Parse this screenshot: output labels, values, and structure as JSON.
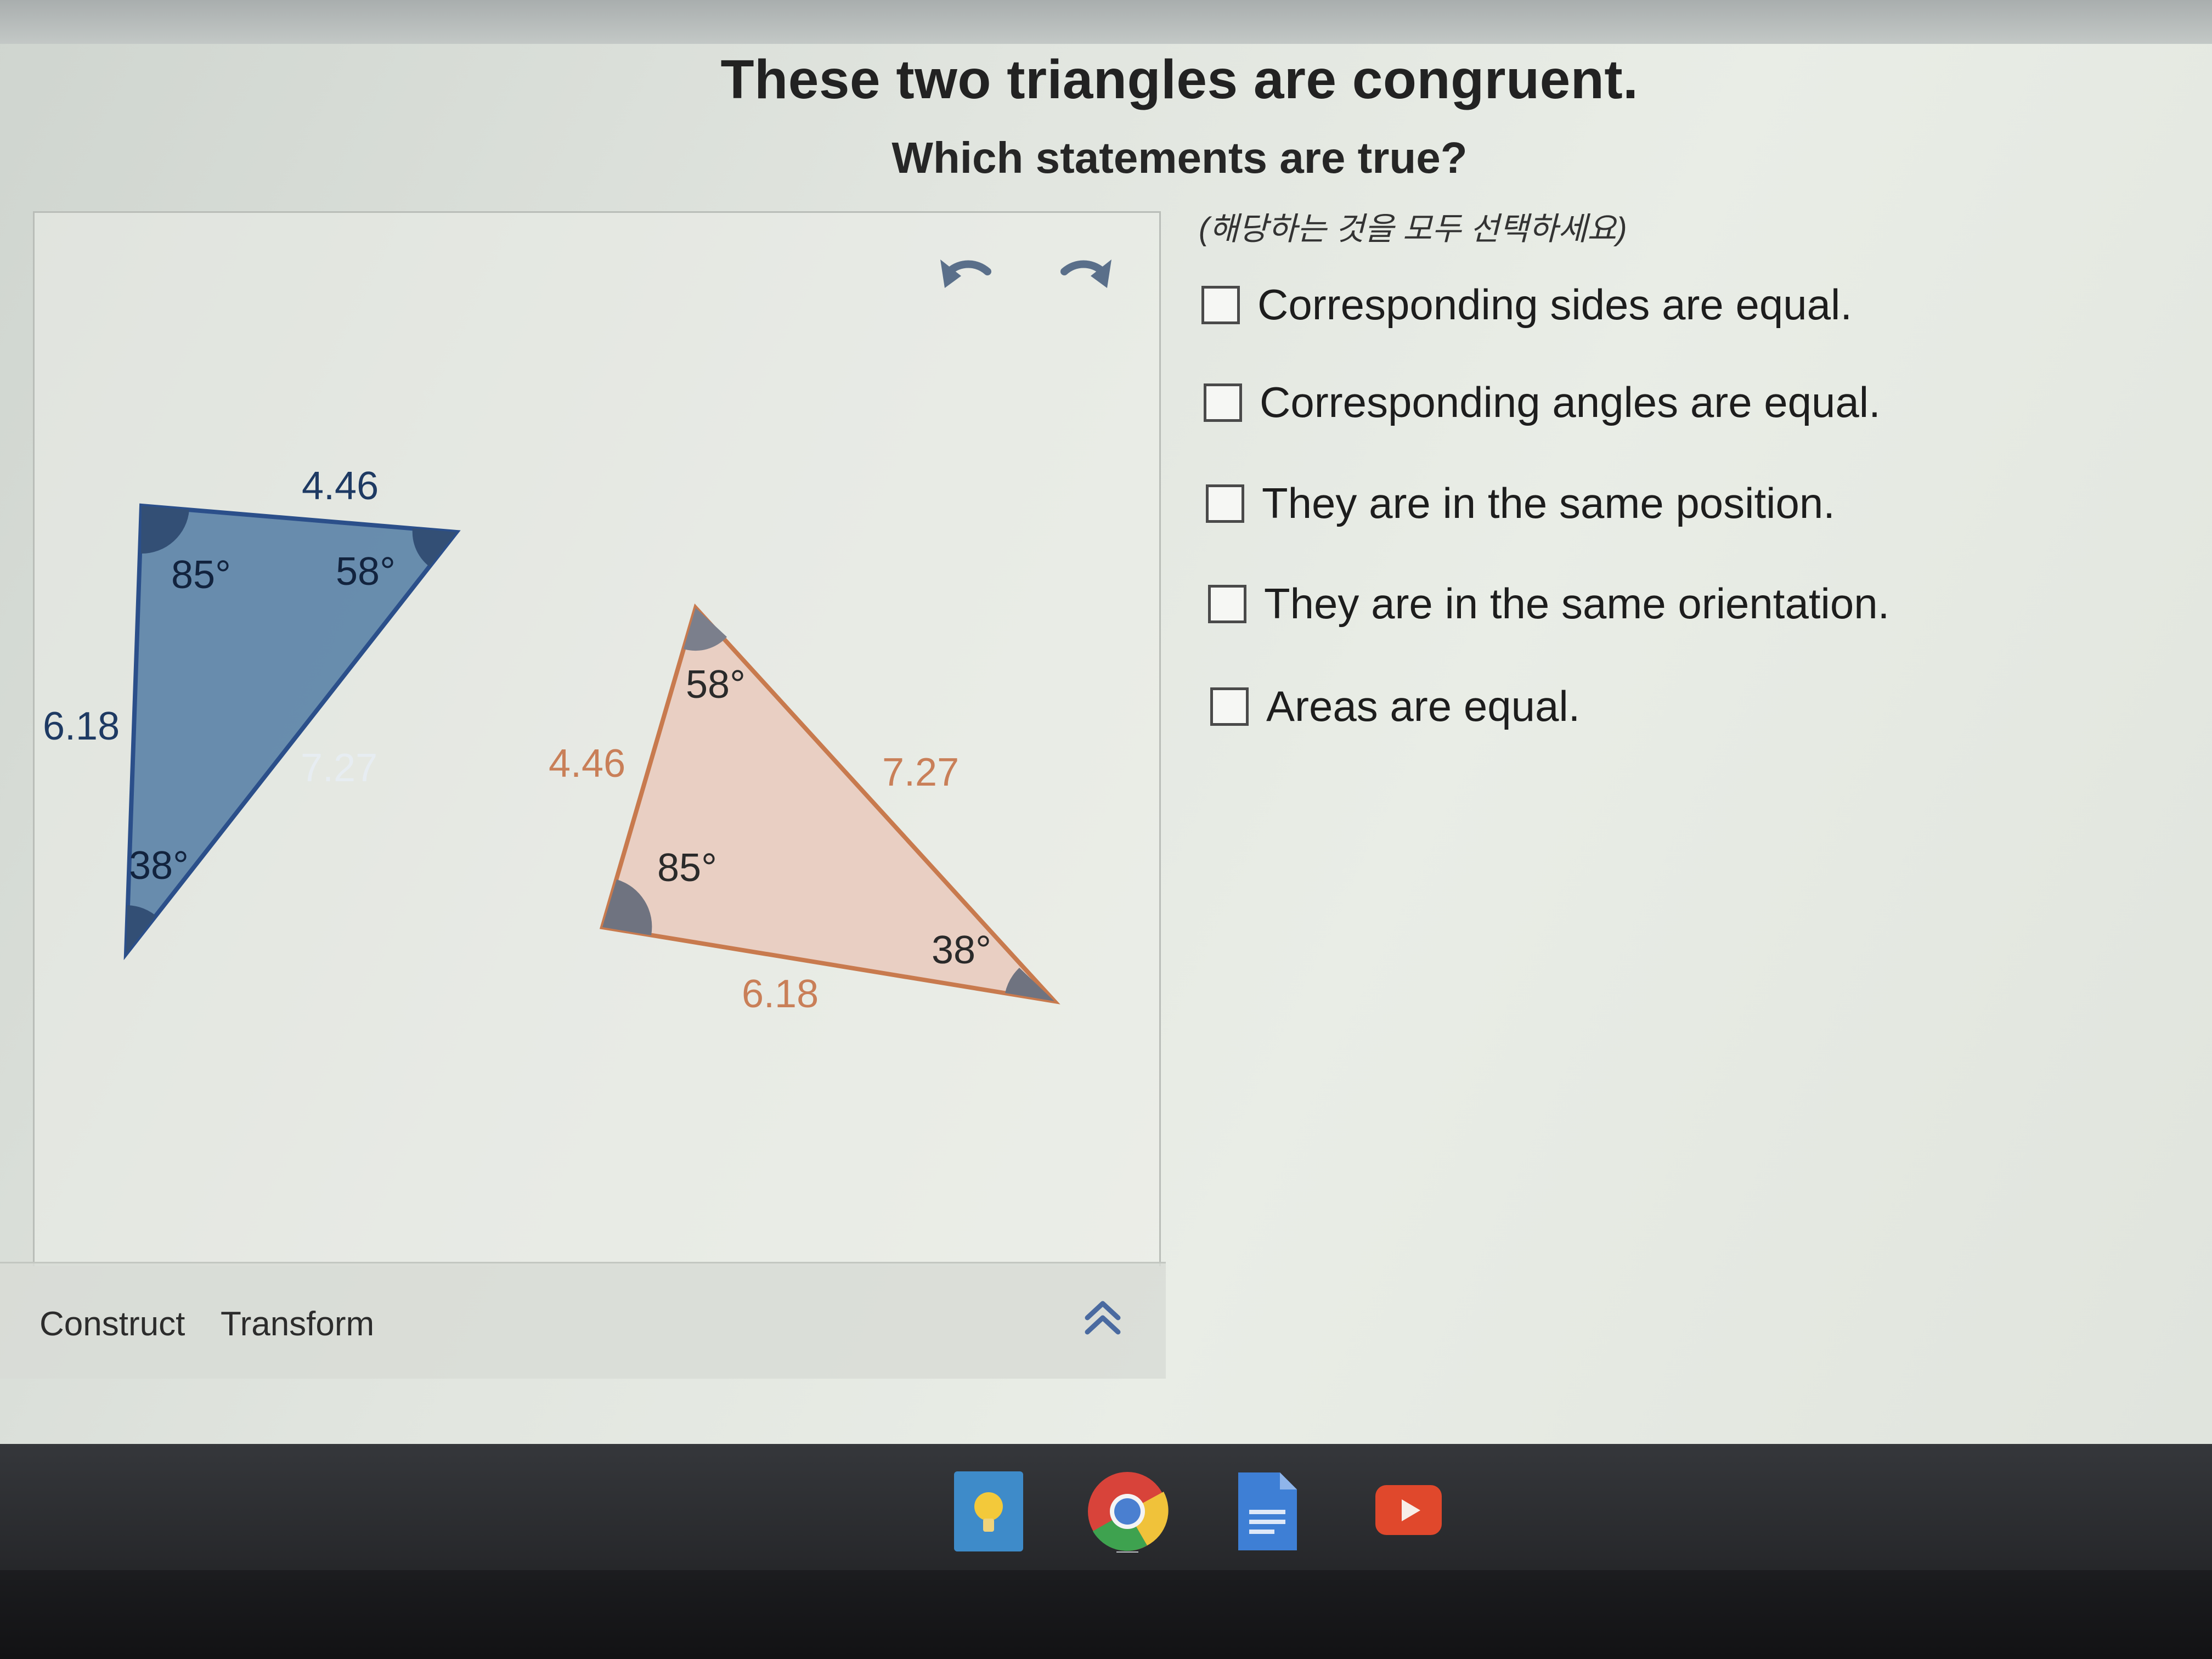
{
  "question": {
    "title": "These two triangles are congruent.",
    "prompt": "Which statements are true?",
    "hint": "(해당하는 것을 모두 선택하세요)"
  },
  "options": [
    {
      "label": "Corresponding sides are equal.",
      "checked": false
    },
    {
      "label": "Corresponding angles are equal.",
      "checked": false
    },
    {
      "label": "They are in the same position.",
      "checked": false
    },
    {
      "label": "They are in the same orientation.",
      "checked": false
    },
    {
      "label": "Areas are equal.",
      "checked": false
    }
  ],
  "workspace": {
    "blue_triangle": {
      "sides": {
        "top": "4.46",
        "left": "6.18",
        "hypotenuse": "7.27"
      },
      "angles": {
        "top_left": "85°",
        "top_right": "58°",
        "bottom": "38°"
      },
      "fill": "#5d84a8",
      "stroke": "#2b4f8a"
    },
    "orange_triangle": {
      "sides": {
        "left": "4.46",
        "right": "7.27",
        "bottom": "6.18"
      },
      "angles": {
        "top": "58°",
        "left": "85°",
        "right": "38°"
      },
      "fill": "#e9cfc3",
      "stroke": "#c87a4e",
      "label_color": "#c97f58"
    }
  },
  "toolbar": {
    "tabs": [
      "Construct",
      "Transform"
    ]
  },
  "shelf": {
    "apps": [
      "keep-app",
      "chrome-app",
      "docs-app",
      "youtube-app"
    ]
  }
}
